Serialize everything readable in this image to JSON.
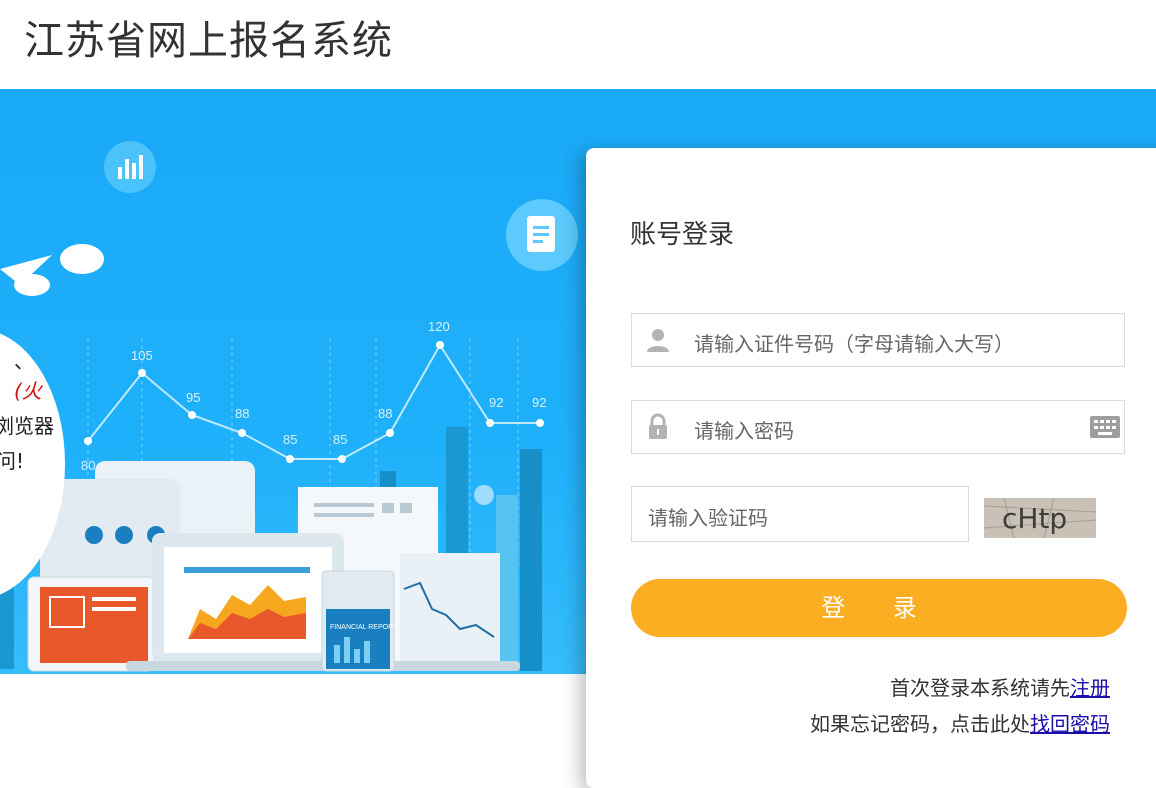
{
  "header": {
    "site_title": "江苏省网上报名系统"
  },
  "banner": {
    "notice_lines": [
      "、",
      "(火",
      "浏览器",
      "问!"
    ],
    "chart_values": [
      "80",
      "105",
      "95",
      "88",
      "85",
      "85",
      "88",
      "120",
      "92",
      "92"
    ],
    "report_label": "FINANCIAL REPORT"
  },
  "login": {
    "title": "账号登录",
    "id_placeholder": "请输入证件号码（字母请输入大写）",
    "password_placeholder": "请输入密码",
    "captcha_placeholder": "请输入验证码",
    "captcha_text": "cHtp",
    "submit_label": "登 录",
    "register_prompt": "首次登录本系统请先",
    "register_link": "注册",
    "forgot_prompt": "如果忘记密码，点击此处",
    "forgot_link": "找回密码"
  },
  "colors": {
    "banner_blue": "#1fb0fb",
    "button_orange": "#fcae23",
    "link_blue": "#1a0dab"
  }
}
